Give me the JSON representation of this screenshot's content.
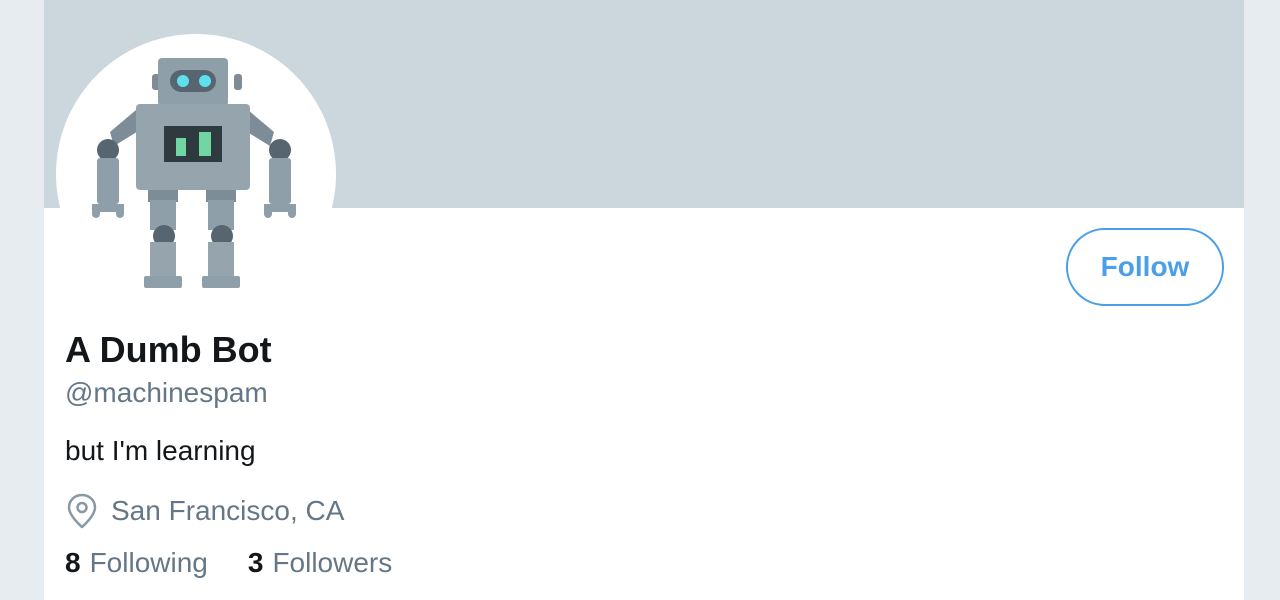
{
  "profile": {
    "name": "A Dumb Bot",
    "handle": "@machinespam",
    "bio": "but I'm learning",
    "location": "San Francisco, CA",
    "location_icon": "map-pin-icon",
    "avatar_icon": "robot-avatar"
  },
  "actions": {
    "follow_label": "Follow"
  },
  "stats": {
    "following_count": "8",
    "following_label": "Following",
    "followers_count": "3",
    "followers_label": "Followers"
  },
  "colors": {
    "banner": "#ccd6dd",
    "accent": "#4a9fe8",
    "text_primary": "#14171a",
    "text_secondary": "#657786",
    "page_background": "#e6ecf0"
  }
}
